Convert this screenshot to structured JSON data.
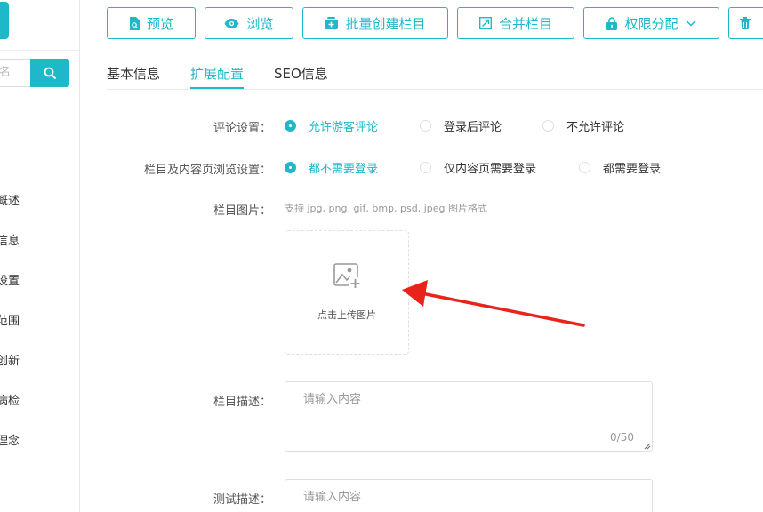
{
  "sidebar": {
    "search_placeholder": "名",
    "items": [
      {
        "label": "概述"
      },
      {
        "label": "信息"
      },
      {
        "label": "设置"
      },
      {
        "label": "范围"
      },
      {
        "label": "创新"
      },
      {
        "label": "病检"
      },
      {
        "label": "理念"
      }
    ]
  },
  "toolbar": {
    "preview_label": "预览",
    "browse_label": "浏览",
    "batch_create_label": "批量创建栏目",
    "merge_label": "合并栏目",
    "permission_label": "权限分配"
  },
  "tabs": [
    {
      "label": "基本信息"
    },
    {
      "label": "扩展配置"
    },
    {
      "label": "SEO信息"
    }
  ],
  "form": {
    "comment_setting": {
      "label": "评论设置：",
      "options": [
        "允许游客评论",
        "登录后评论",
        "不允许评论"
      ],
      "selected": "允许游客评论"
    },
    "browse_setting": {
      "label": "栏目及内容页浏览设置：",
      "options": [
        "都不需要登录",
        "仅内容页需要登录",
        "都需要登录"
      ],
      "selected": "都不需要登录"
    },
    "image": {
      "label": "栏目图片：",
      "hint": "支持 jpg, png, gif, bmp, psd, jpeg 图片格式",
      "upload_text": "点击上传图片"
    },
    "description": {
      "label": "栏目描述：",
      "placeholder": "请输入内容",
      "counter": "0/50"
    },
    "test_description": {
      "label": "测试描述：",
      "placeholder": "请输入内容"
    }
  },
  "colors": {
    "accent": "#1fb8c9",
    "annotation_arrow": "#e8231b"
  }
}
